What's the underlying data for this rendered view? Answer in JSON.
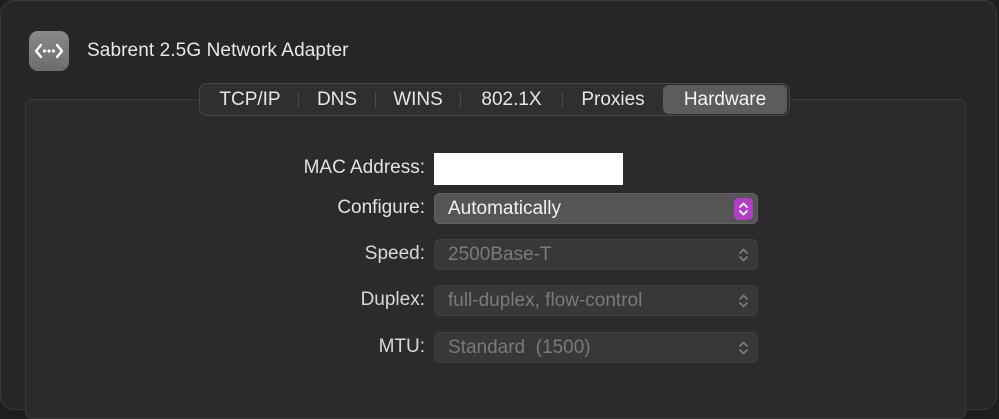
{
  "header": {
    "title": "Sabrent 2.5G Network Adapter",
    "icon": "network-adapter-icon"
  },
  "tabs": [
    {
      "label": "TCP/IP",
      "selected": false
    },
    {
      "label": "DNS",
      "selected": false
    },
    {
      "label": "WINS",
      "selected": false
    },
    {
      "label": "802.1X",
      "selected": false
    },
    {
      "label": "Proxies",
      "selected": false
    },
    {
      "label": "Hardware",
      "selected": true
    }
  ],
  "form": {
    "mac_label": "MAC Address:",
    "mac_value": "",
    "configure_label": "Configure:",
    "configure_value": "Automatically",
    "speed_label": "Speed:",
    "speed_value": "2500Base-T",
    "duplex_label": "Duplex:",
    "duplex_value": "full-duplex, flow-control",
    "mtu_label": "MTU:",
    "mtu_value": "Standard  (1500)"
  },
  "colors": {
    "accent": "#b23ec8",
    "selected_tab": "#5c5c5c"
  }
}
